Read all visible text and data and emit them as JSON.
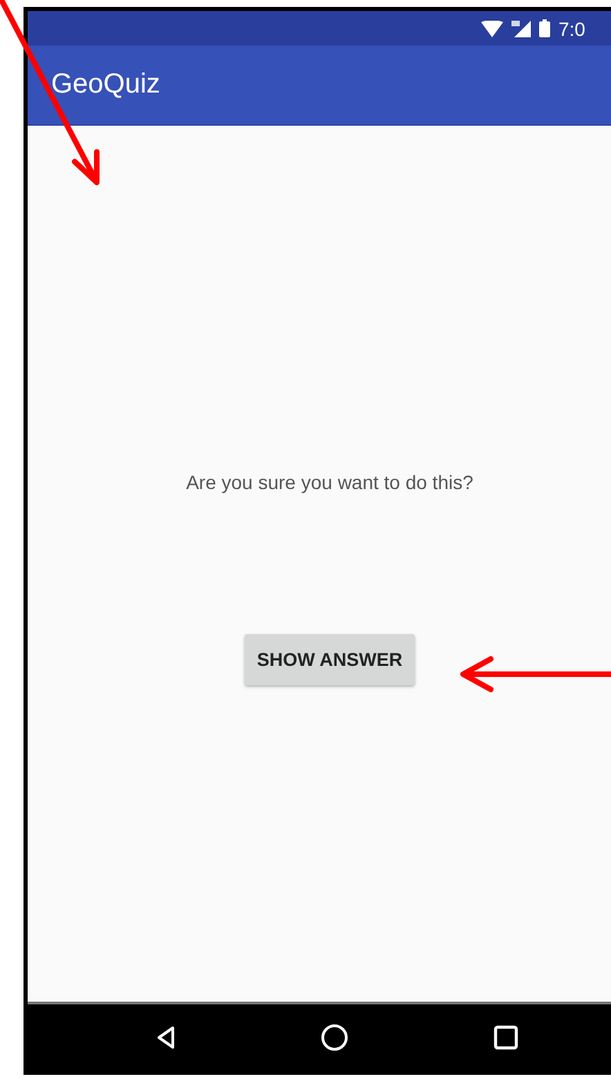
{
  "status_bar": {
    "time": "7:0"
  },
  "app_bar": {
    "title": "GeoQuiz"
  },
  "content": {
    "question": "Are you sure you want to do this?",
    "button": "SHOW ANSWER"
  }
}
